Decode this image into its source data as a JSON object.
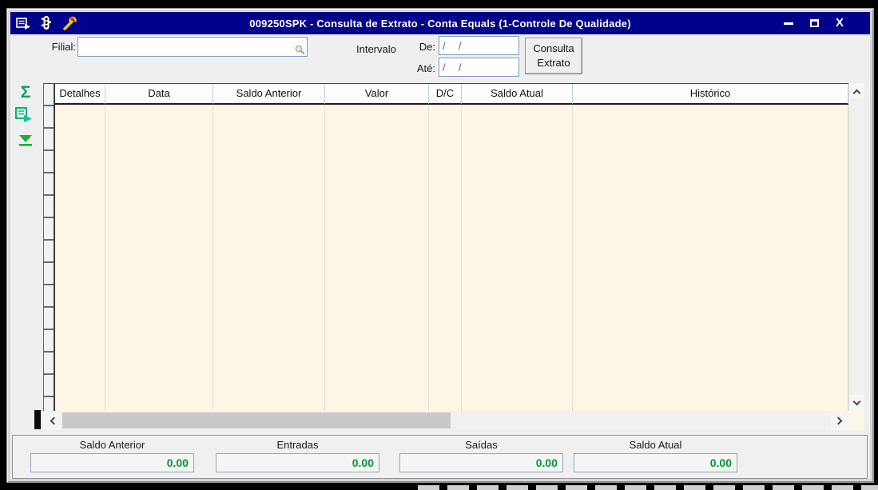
{
  "window": {
    "title": "009250SPK - Consulta de Extrato - Conta Equals (1-Controle De Qualidade)",
    "close_glyph": "X"
  },
  "form": {
    "filial_label": "Filial:",
    "filial_value": "",
    "intervalo_label": "Intervalo",
    "de_label": "De:",
    "de_value": "/  /",
    "ate_label": "Até:",
    "ate_value": "/  /",
    "consulta_button_line1": "Consulta",
    "consulta_button_line2": "Extrato"
  },
  "sidebar": {
    "sigma_icon_glyph": "Σ"
  },
  "table": {
    "columns": [
      {
        "label": "Detalhes"
      },
      {
        "label": "Data"
      },
      {
        "label": "Saldo Anterior"
      },
      {
        "label": "Valor"
      },
      {
        "label": "D/C"
      },
      {
        "label": "Saldo Atual"
      },
      {
        "label": "Histórico"
      }
    ],
    "rows": []
  },
  "summary": {
    "items": [
      {
        "label": "Saldo Anterior",
        "value": "0.00"
      },
      {
        "label": "Entradas",
        "value": "0.00"
      },
      {
        "label": "Saídas",
        "value": "0.00"
      },
      {
        "label": "Saldo Atual",
        "value": "0.00"
      }
    ]
  },
  "colors": {
    "titlebar": "#00008B",
    "grid_body": "#FCF7E4",
    "value_green": "#009933",
    "date_text": "#5A50CC"
  }
}
